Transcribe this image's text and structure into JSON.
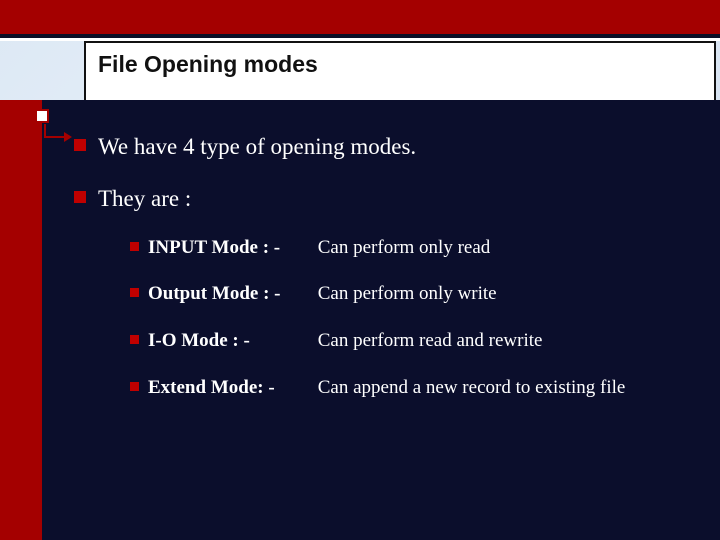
{
  "title": "File Opening modes",
  "points": {
    "p1": "We have 4 type of opening modes.",
    "p2": "They are :"
  },
  "modes": [
    {
      "label": "INPUT Mode : -",
      "desc": "Can perform only read"
    },
    {
      "label": "Output Mode : -",
      "desc": "Can perform only write"
    },
    {
      "label": "I-O Mode : -",
      "desc": "Can perform read and rewrite"
    },
    {
      "label": "Extend  Mode: -",
      "desc": "Can append a new record to existing file"
    }
  ]
}
